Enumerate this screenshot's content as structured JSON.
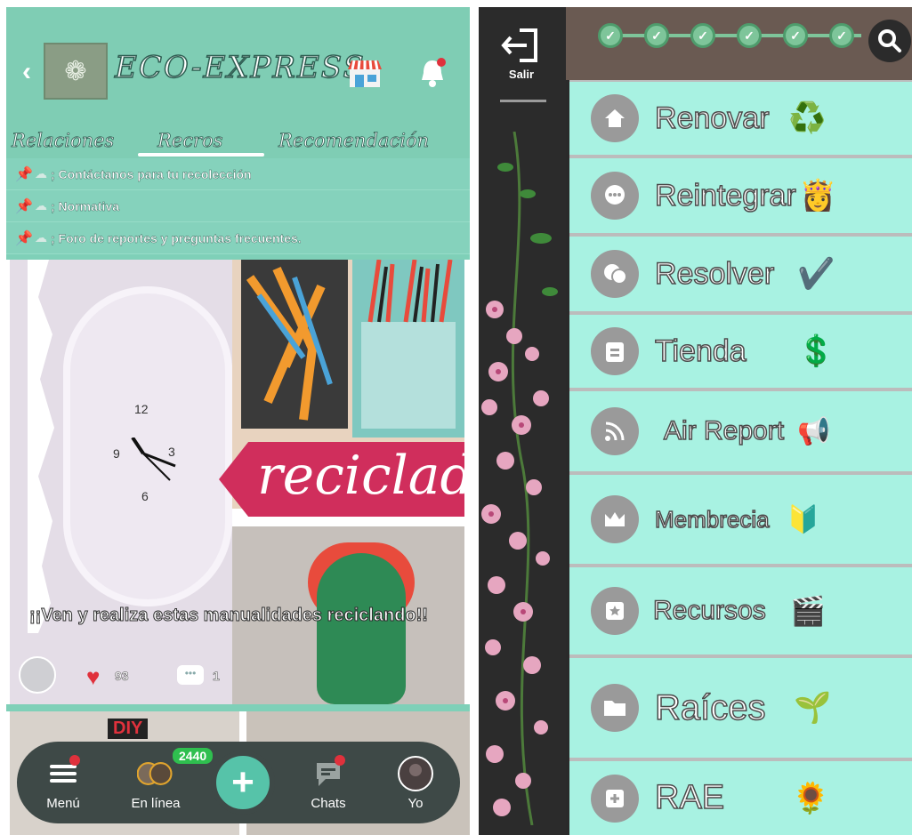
{
  "left": {
    "header": {
      "back_glyph": "‹",
      "title": "ECO-EXPRESS",
      "logo_glyph": "❁"
    },
    "tabs": [
      {
        "label": "Relaciones"
      },
      {
        "label": "Recros"
      },
      {
        "label": "Recomendación"
      }
    ],
    "pinned": [
      {
        "text": "; Contáctanos para tu recolección"
      },
      {
        "text": "; Normativa"
      },
      {
        "text": "; Foro de reportes y preguntas frecuentes."
      }
    ],
    "post": {
      "banner_text": "reciclado",
      "title": "¡¡Ven y realiza estas manualidades reciclando!!",
      "likes": "93",
      "comments": "1",
      "clock_numbers": [
        "12",
        "3",
        "6",
        "9"
      ]
    },
    "next_post": {
      "label": "DIY"
    },
    "bottom_nav": {
      "menu": "Menú",
      "online": "En línea",
      "online_count": "2440",
      "plus": "+",
      "chats": "Chats",
      "me": "Yo"
    }
  },
  "right": {
    "exit_label": "Salir",
    "progress_checks": 6,
    "menu": [
      {
        "label": "Renovar",
        "icon": "home-icon",
        "emoji": "♻️"
      },
      {
        "label": "Reintegrar",
        "icon": "chat-bubble-icon",
        "emoji": "👸"
      },
      {
        "label": "Resolver",
        "icon": "chat-double-icon",
        "emoji": "✔️"
      },
      {
        "label": "Tienda",
        "icon": "clipboard-icon",
        "emoji": "💲"
      },
      {
        "label": "Air Report",
        "icon": "rss-icon",
        "emoji": "📢"
      },
      {
        "label": "Membrecia",
        "icon": "crown-icon",
        "emoji": "🔰"
      },
      {
        "label": "Recursos",
        "icon": "star-square-icon",
        "emoji": "🎬"
      },
      {
        "label": "Raíces",
        "icon": "folder-icon",
        "emoji": "🌱"
      },
      {
        "label": "RAE",
        "icon": "plus-square-icon",
        "emoji": "🌻"
      }
    ]
  },
  "colors": {
    "mint_header": "#7fcdb4",
    "menu_item": "#a8f2e2",
    "nav_bar": "#3e4947",
    "accent_green": "#56c3a9",
    "badge_red": "#e0313c",
    "banner_pink": "#d02e5c"
  }
}
